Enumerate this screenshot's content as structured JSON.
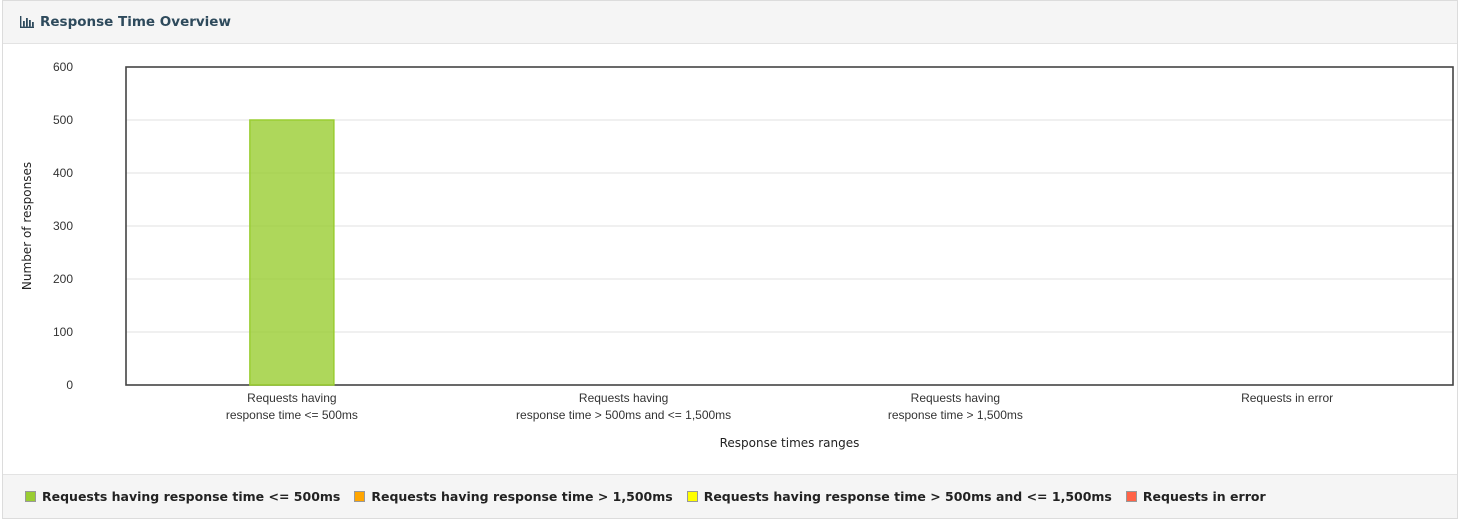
{
  "panel": {
    "title": "Response Time Overview",
    "icon": "bar-chart-icon"
  },
  "chart_data": {
    "type": "bar",
    "categories": [
      [
        "Requests having",
        "response time <= 500ms"
      ],
      [
        "Requests having",
        "response time > 500ms and <= 1,500ms"
      ],
      [
        "Requests having",
        "response time > 1,500ms"
      ],
      [
        "Requests in error"
      ]
    ],
    "values": [
      500,
      0,
      0,
      0
    ],
    "colors": [
      "#9ACD32",
      "#FFA500",
      "#FFFF00",
      "#FF6347"
    ],
    "xlabel": "Response times ranges",
    "ylabel": "Number of responses",
    "ylim": [
      0,
      600
    ],
    "yticks": [
      0,
      100,
      200,
      300,
      400,
      500,
      600
    ],
    "grid": true,
    "legend_placement": "bottom"
  },
  "legend": {
    "items": [
      {
        "label": "Requests having response time <= 500ms",
        "color": "#9ACD32"
      },
      {
        "label": "Requests having response time > 1,500ms",
        "color": "#FFA500"
      },
      {
        "label": "Requests having response time > 500ms and <= 1,500ms",
        "color": "#FFFF00"
      },
      {
        "label": "Requests in error",
        "color": "#FF6347"
      }
    ]
  }
}
